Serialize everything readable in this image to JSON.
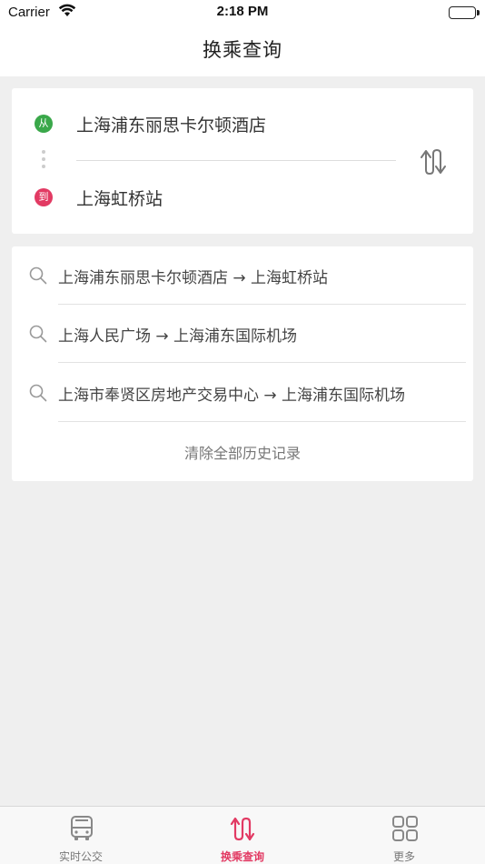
{
  "status_bar": {
    "carrier": "Carrier",
    "time": "2:18 PM"
  },
  "nav": {
    "title": "换乘查询"
  },
  "route": {
    "from_badge": "从",
    "to_badge": "到",
    "from": "上海浦东丽思卡尔顿酒店",
    "to": "上海虹桥站"
  },
  "history": {
    "items": [
      {
        "text": "上海浦东丽思卡尔顿酒店 → 上海虹桥站"
      },
      {
        "text": "上海人民广场 → 上海浦东国际机场"
      },
      {
        "text": "上海市奉贤区房地产交易中心 → 上海浦东国际机场"
      }
    ],
    "clear_label": "清除全部历史记录"
  },
  "tabs": [
    {
      "label": "实时公交",
      "icon": "bus-icon",
      "active": false
    },
    {
      "label": "换乘查询",
      "icon": "transfer-icon",
      "active": true
    },
    {
      "label": "更多",
      "icon": "grid-icon",
      "active": false
    }
  ],
  "colors": {
    "accent": "#e23a63",
    "from_green": "#3aa84a",
    "background": "#efefef"
  }
}
